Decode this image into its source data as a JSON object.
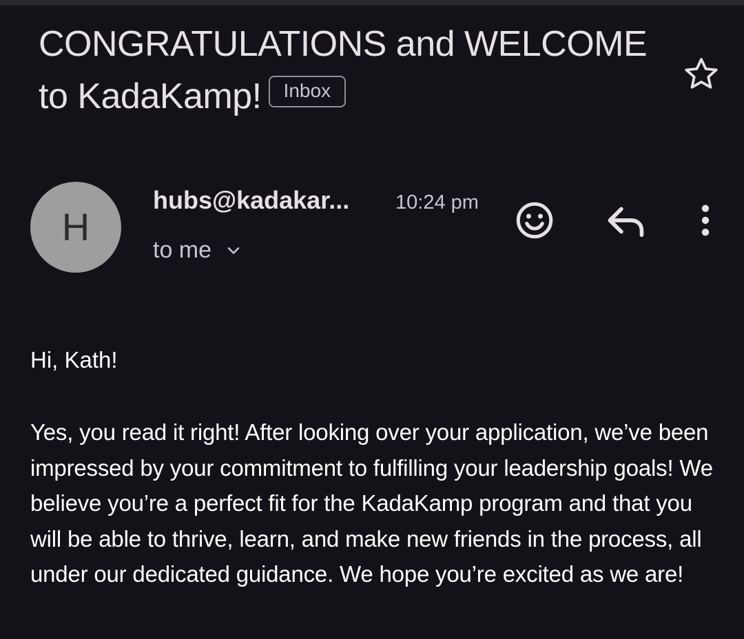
{
  "email": {
    "subject": "CONGRATULATIONS and WELCOME to KadaKamp!",
    "label_badge": "Inbox",
    "avatar_letter": "H",
    "sender": "hubs@kadakar...",
    "time": "10:24 pm",
    "recipient": "to me",
    "greeting": "Hi, Kath!",
    "body": "Yes, you read it right! After looking over your application, we’ve been impressed by your commitment to fulfilling your leadership goals! We believe you’re a perfect fit for the KadaKamp program and that you will be able to thrive, learn, and make new friends in the process, all under our dedicated guidance. We hope you’re excited as we are!"
  },
  "icons": {
    "star": "star-outline-icon",
    "recipient_expand": "chevron-down-icon",
    "react": "emoji-icon",
    "reply": "reply-icon",
    "more": "more-vert-icon"
  },
  "colors": {
    "background": "#141218",
    "text": "#e6e1e5",
    "secondary_text": "#cac4d0",
    "avatar_bg": "#9e9e9e"
  }
}
